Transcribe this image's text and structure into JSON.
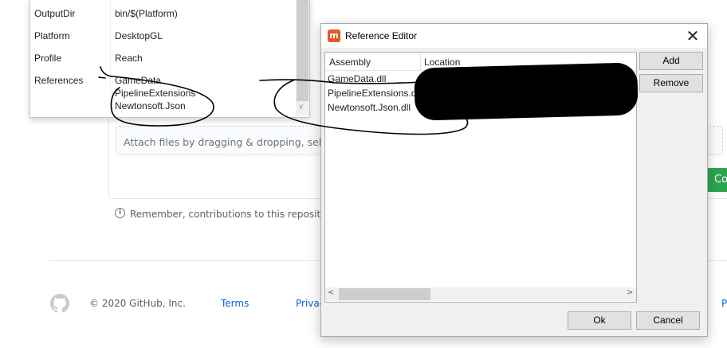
{
  "github": {
    "attach_text": "Attach files by dragging & dropping, selec",
    "commit_button_label": "Co",
    "remember_text": "Remember, contributions to this repository sh",
    "footer": {
      "copyright": "© 2020 GitHub, Inc.",
      "links": [
        "Terms",
        "Privac",
        "P"
      ]
    }
  },
  "property_grid": {
    "rows": [
      {
        "name": "OutputDir",
        "value": "bin/$(Platform)"
      },
      {
        "name": "Platform",
        "value": "DesktopGL"
      },
      {
        "name": "Profile",
        "value": "Reach"
      },
      {
        "name": "References",
        "values": [
          "GameData",
          "PipelineExtensions",
          "Newtonsoft.Json"
        ]
      }
    ]
  },
  "reference_editor": {
    "title": "Reference Editor",
    "columns": [
      "Assembly",
      "Location"
    ],
    "rows": [
      "GameData.dll",
      "PipelineExtensions.dll",
      "Newtonsoft.Json.dll"
    ],
    "buttons": {
      "add": "Add",
      "remove": "Remove",
      "ok": "Ok",
      "cancel": "Cancel"
    }
  },
  "icons": {
    "dialog_icon": "monogame-icon",
    "close": "close-icon",
    "info": "info-icon",
    "github_logo": "github-logo-icon"
  },
  "colors": {
    "commit_green": "#2ea44f",
    "link_blue": "#0366d6",
    "dialog_icon": "#e6582a"
  }
}
